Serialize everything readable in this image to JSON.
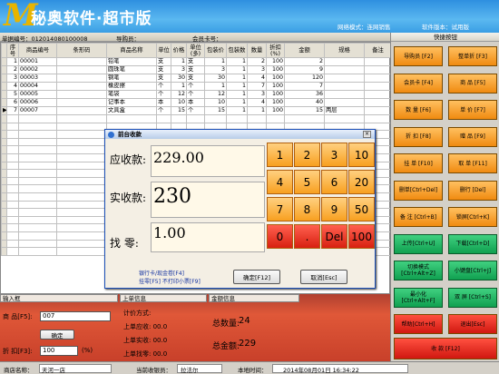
{
  "app": {
    "title": "秘奥软件·超市版",
    "logo": "M",
    "network_mode": "网络模式：连网销售",
    "version": "软件版本：试用版"
  },
  "infobar": {
    "order_no": "单据编号：012014080100008",
    "guide": "导购员：",
    "member_card": "会员卡号："
  },
  "grid": {
    "columns": [
      "序号",
      "商品编号",
      "条形码",
      "商品名称",
      "单位",
      "价格",
      "单位(多)",
      "包装价",
      "包装数",
      "数量",
      "折扣(%)",
      "金额",
      "规格",
      "备注"
    ],
    "rows": [
      [
        "1",
        "00001",
        "",
        "铅笔",
        "支",
        "1",
        "支",
        "1",
        "1",
        "2",
        "100",
        "2",
        "",
        ""
      ],
      [
        "2",
        "00002",
        "",
        "圆珠笔",
        "支",
        "3",
        "支",
        "3",
        "1",
        "3",
        "100",
        "9",
        "",
        ""
      ],
      [
        "3",
        "00003",
        "",
        "钢笔",
        "支",
        "30",
        "支",
        "30",
        "1",
        "4",
        "100",
        "120",
        "",
        ""
      ],
      [
        "4",
        "00004",
        "",
        "橡皮擦",
        "个",
        "1",
        "个",
        "1",
        "1",
        "7",
        "100",
        "7",
        "",
        ""
      ],
      [
        "5",
        "00005",
        "",
        "笔袋",
        "个",
        "12",
        "个",
        "12",
        "1",
        "3",
        "100",
        "36",
        "",
        ""
      ],
      [
        "6",
        "00006",
        "",
        "记事本",
        "本",
        "10",
        "本",
        "10",
        "1",
        "4",
        "100",
        "40",
        "",
        ""
      ],
      [
        "7",
        "00007",
        "",
        "文具盒",
        "个",
        "15",
        "个",
        "15",
        "1",
        "1",
        "100",
        "15",
        "两层",
        ""
      ]
    ],
    "current_row_marker": "▶"
  },
  "quick_panel": {
    "title": "快捷按钮",
    "buttons": [
      {
        "label": "导购员 [F2]",
        "style": "o"
      },
      {
        "label": "整单折 [F3]",
        "style": "o"
      },
      {
        "label": "会员卡 [F4]",
        "style": "o"
      },
      {
        "label": "商 品 [F5]",
        "style": "o"
      },
      {
        "label": "数 量 [F6]",
        "style": "o"
      },
      {
        "label": "单 价 [F7]",
        "style": "o"
      },
      {
        "label": "折 扣 [F8]",
        "style": "o"
      },
      {
        "label": "赠 品 [F9]",
        "style": "o"
      },
      {
        "label": "挂 单 [F10]",
        "style": "o"
      },
      {
        "label": "取 单 [F11]",
        "style": "o"
      },
      {
        "label": "删单[Ctrl+Del]",
        "style": "o"
      },
      {
        "label": "删行 [Del]",
        "style": "o"
      },
      {
        "label": "备 注 [Ctrl+B]",
        "style": "o"
      },
      {
        "label": "锁屏[Ctrl+K]",
        "style": "o"
      },
      {
        "label": "上传[Ctrl+U]",
        "style": "g"
      },
      {
        "label": "下载[Ctrl+D]",
        "style": "g"
      },
      {
        "label": "切换模式 [Ctrl+Alt+Z]",
        "style": "g"
      },
      {
        "label": "小键盘[Ctrl+J]",
        "style": "g"
      },
      {
        "label": "最小化[Ctrl+Alt+F]",
        "style": "g"
      },
      {
        "label": "双 屏 [Ctrl+S]",
        "style": "g"
      },
      {
        "label": "帮助[Ctrl+H]",
        "style": "r"
      },
      {
        "label": "退出[Esc]",
        "style": "r"
      }
    ],
    "settle_button": "收 款 [F12]"
  },
  "bottom": {
    "input_header": "输入框",
    "product_label": "商 品[F5]:",
    "product_value": "007",
    "confirm": "确定",
    "discount_label": "折 扣[F3]:",
    "discount_value": "100",
    "discount_unit": "(%)",
    "last_header": "上单信息",
    "pay_method": "计价方式:",
    "last_due": "上单应收: 00.0",
    "last_paid": "上单实收: 00.0",
    "last_change": "上单找零: 00.0",
    "total_header": "金额信息",
    "total_qty_label": "总数量:",
    "total_qty": "24",
    "total_amt_label": "总金额:",
    "total_amt": "229"
  },
  "status": {
    "store_label": "商店名称：",
    "store": "天河一店",
    "cashier_label": "当前收银员：",
    "cashier": "拉法尔",
    "time_label": "本地时间：",
    "time": "2014年08月01日 16:34:22"
  },
  "dialog": {
    "title": "前台收款",
    "close": "×",
    "due_label": "应收款:",
    "due_value": "229.00",
    "paid_label": "实收款:",
    "paid_value": "230",
    "change_label": "找  零:",
    "change_value": "1.00",
    "hint1": "银行卡/现金卷[F4]",
    "hint2": "挂零[F5] 不打印小票[F9]",
    "ok": "确定[F12]",
    "cancel": "取消[Esc]",
    "keys": [
      "1",
      "2",
      "3",
      "10",
      "4",
      "5",
      "6",
      "20",
      "7",
      "8",
      "9",
      "50",
      "0",
      ".",
      "Del",
      "100"
    ]
  }
}
